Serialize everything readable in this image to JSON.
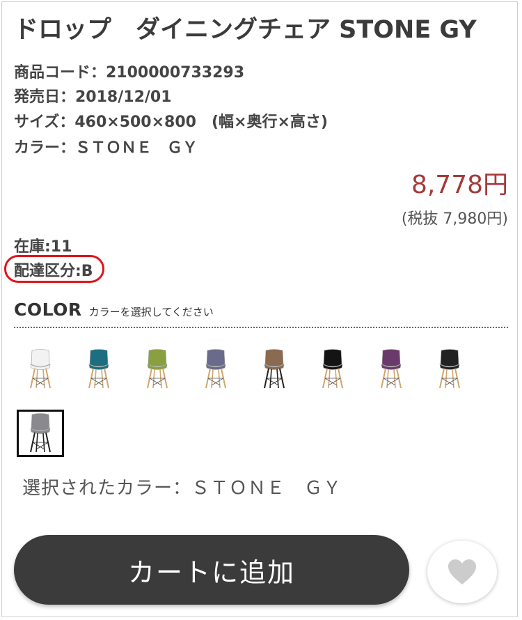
{
  "product": {
    "title": "ドロップ　ダイニングチェア STONE GY",
    "code_line": "商品コード：2100000733293",
    "release_line": "発売日：2018/12/01",
    "size_line": "サイズ：460×500×800　(幅×奥行×高さ)",
    "color_line": "カラー：ＳＴＯＮＥ　ＧＹ"
  },
  "pricing": {
    "price": "8,778円",
    "price_ex_tax": "(税抜 7,980円)"
  },
  "stock": {
    "stock_line": "在庫:11",
    "delivery_line": "配達区分:B",
    "highlight_color": "#e0141a"
  },
  "color_picker": {
    "heading": "COLOR",
    "subheading": "カラーを選択してください",
    "swatches": [
      {
        "name": "white",
        "seat": "#f2f2f2",
        "legs": "wood"
      },
      {
        "name": "teal",
        "seat": "#1d6e80",
        "legs": "wood"
      },
      {
        "name": "olive",
        "seat": "#8aa040",
        "legs": "wood"
      },
      {
        "name": "patchwork",
        "seat": "#6a6a8a",
        "legs": "wood"
      },
      {
        "name": "brown",
        "seat": "#8a6a50",
        "legs": "black"
      },
      {
        "name": "black",
        "seat": "#141414",
        "legs": "wood"
      },
      {
        "name": "purple",
        "seat": "#6a3a6a",
        "legs": "wood"
      },
      {
        "name": "monochrome",
        "seat": "#222222",
        "legs": "wood"
      },
      {
        "name": "stone-gy",
        "seat": "#8a8a8e",
        "legs": "black",
        "selected": true
      }
    ],
    "selected_label": "選択されたカラー：ＳＴＯＮＥ　ＧＹ"
  },
  "actions": {
    "add_to_cart": "カートに追加",
    "favorite_icon": "heart-icon"
  },
  "colors": {
    "price": "#a43a3a",
    "cart_button": "#3b3b3b",
    "heart": "#cccccc"
  }
}
